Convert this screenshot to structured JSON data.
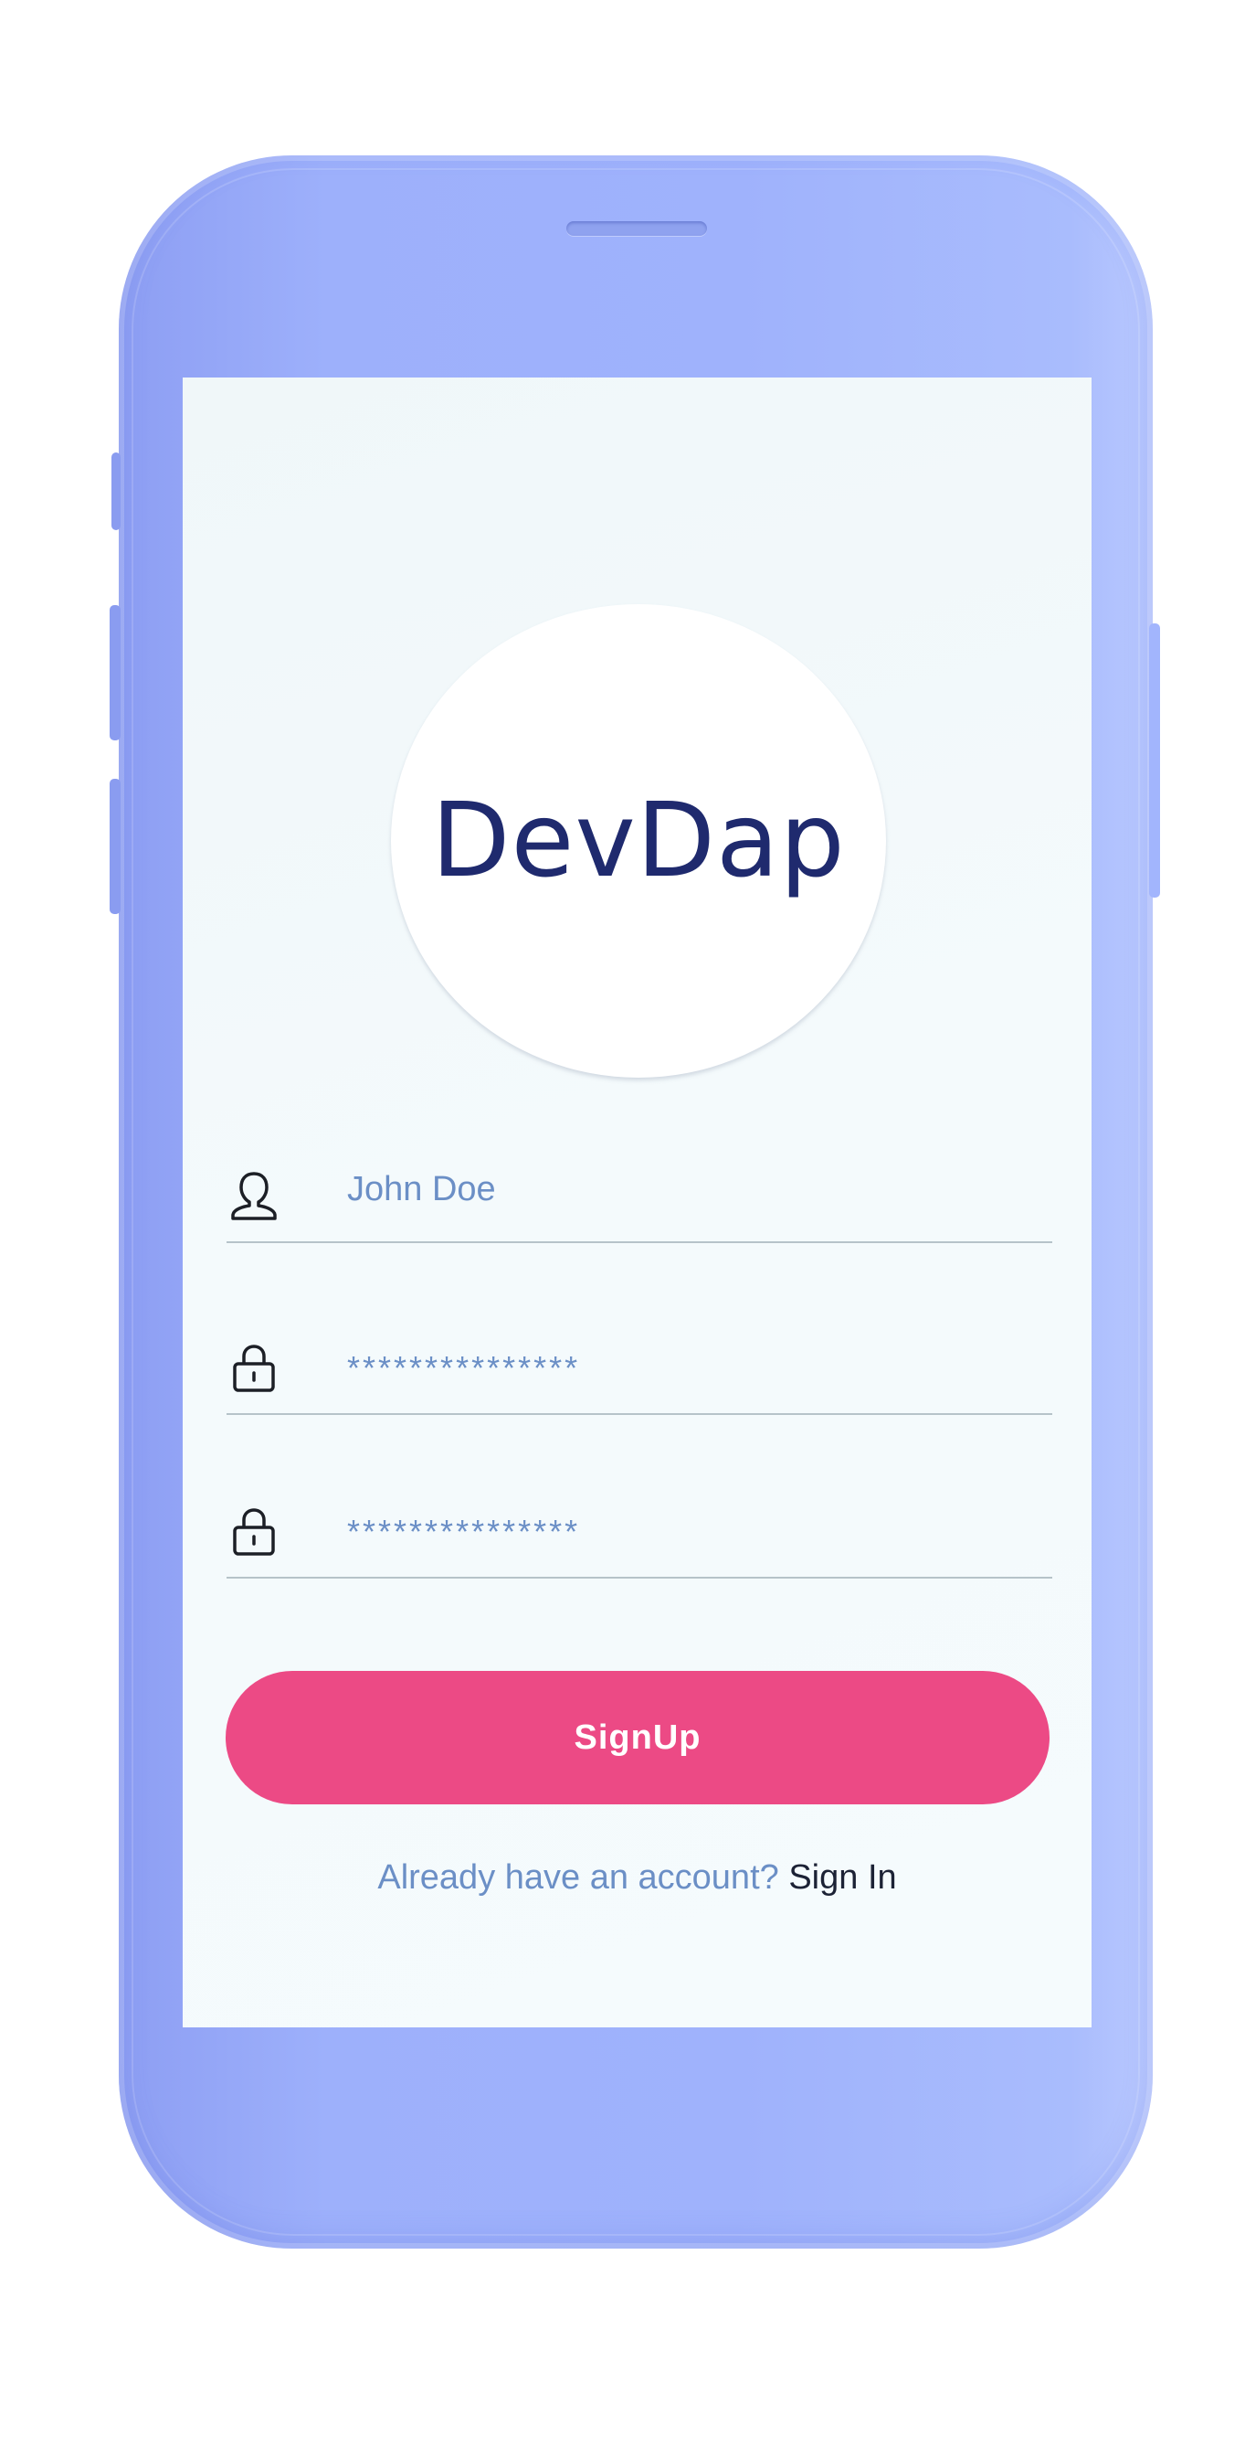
{
  "app": {
    "logo_text": "DevDap"
  },
  "form": {
    "username": {
      "value": "John Doe",
      "icon": "user-icon"
    },
    "password": {
      "value": "***************",
      "icon": "lock-icon"
    },
    "confirm_password": {
      "value": "***************",
      "icon": "lock-icon"
    },
    "submit_label": "SignUp"
  },
  "footer": {
    "prompt": "Already have an account?",
    "link_label": "Sign In"
  },
  "colors": {
    "phone_body": "#9fb2fc",
    "screen_bg": "#f3f9fb",
    "logo_text": "#1f2a6e",
    "input_text": "#6b8fc6",
    "button_bg": "#ec4a85",
    "link_text": "#1c2235"
  }
}
